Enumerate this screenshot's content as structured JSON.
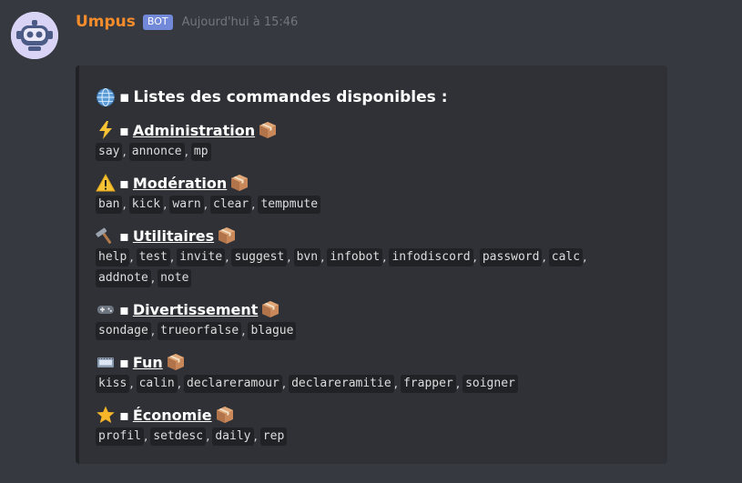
{
  "message": {
    "username": "Umpus",
    "badge": "BOT",
    "timestamp": "Aujourd'hui à 15:46"
  },
  "embed": {
    "title_emoji": "globe-icon",
    "title_separator": "▪",
    "title": "Listes des commandes disponibles :",
    "sections": [
      {
        "emoji": "lightning-icon",
        "name": "Administration",
        "commands": [
          [
            "say",
            "annonce",
            "mp"
          ]
        ]
      },
      {
        "emoji": "warning-icon",
        "name": "Modération",
        "commands": [
          [
            "ban",
            "kick",
            "warn",
            "clear",
            "tempmute"
          ]
        ]
      },
      {
        "emoji": "hammer-icon",
        "name": "Utilitaires",
        "commands": [
          [
            "help",
            "test",
            "invite",
            "suggest",
            "bvn",
            "infobot",
            "infodiscord",
            "password",
            "calc"
          ],
          [
            "addnote",
            "note"
          ]
        ]
      },
      {
        "emoji": "gamepad-icon",
        "name": "Divertissement",
        "commands": [
          [
            "sondage",
            "trueorfalse",
            "blague"
          ]
        ]
      },
      {
        "emoji": "film-icon",
        "name": "Fun",
        "commands": [
          [
            "kiss",
            "calin",
            "declareramour",
            "declareramitie",
            "frapper",
            "soigner"
          ]
        ]
      },
      {
        "emoji": "star-icon",
        "name": "Économie",
        "commands": [
          [
            "profil",
            "setdesc",
            "daily",
            "rep"
          ]
        ]
      }
    ]
  },
  "colors": {
    "background": "#36393f",
    "embed_bg": "#2f3136",
    "username": "#f48c2c",
    "badge": "#7289da",
    "code_bg": "#202225"
  }
}
